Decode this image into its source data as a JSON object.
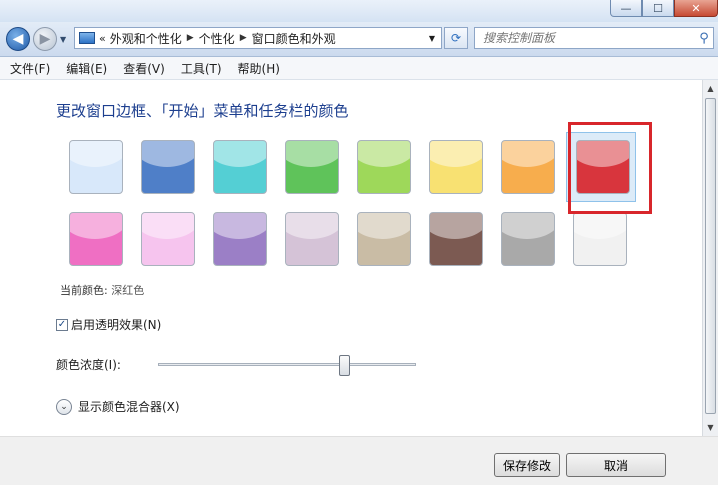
{
  "address": {
    "lead": "«",
    "crumbs": [
      "外观和个性化",
      "个性化",
      "窗口颜色和外观"
    ]
  },
  "search": {
    "placeholder": "搜索控制面板"
  },
  "menu": [
    "文件(F)",
    "编辑(E)",
    "查看(V)",
    "工具(T)",
    "帮助(H)"
  ],
  "heading": "更改窗口边框、「开始」菜单和任务栏的颜色",
  "swatch_colors": {
    "row1": [
      "#d8e8fa",
      "#4f7fc8",
      "#54cfd4",
      "#5fc35a",
      "#9ed85a",
      "#f8e172",
      "#f7ad4d",
      "#d8353d"
    ],
    "row2": [
      "#ef6fc3",
      "#f6c4ee",
      "#9b7fc6",
      "#d5c3d7",
      "#c9bca5",
      "#7c5a52",
      "#a9a9a9",
      "#f1f1f1"
    ]
  },
  "selected_swatch": {
    "row": 1,
    "index": 8
  },
  "current_color": {
    "label": "当前颜色:",
    "name": "深红色"
  },
  "transparency": {
    "label": "启用透明效果(N)",
    "checked": true
  },
  "intensity": {
    "label": "颜色浓度(I):",
    "level_percent": 73
  },
  "mixer": {
    "label": "显示颜色混合器(X)"
  },
  "buttons": {
    "save": "保存修改",
    "cancel": "取消"
  },
  "accent_highlight": "#d8262b"
}
